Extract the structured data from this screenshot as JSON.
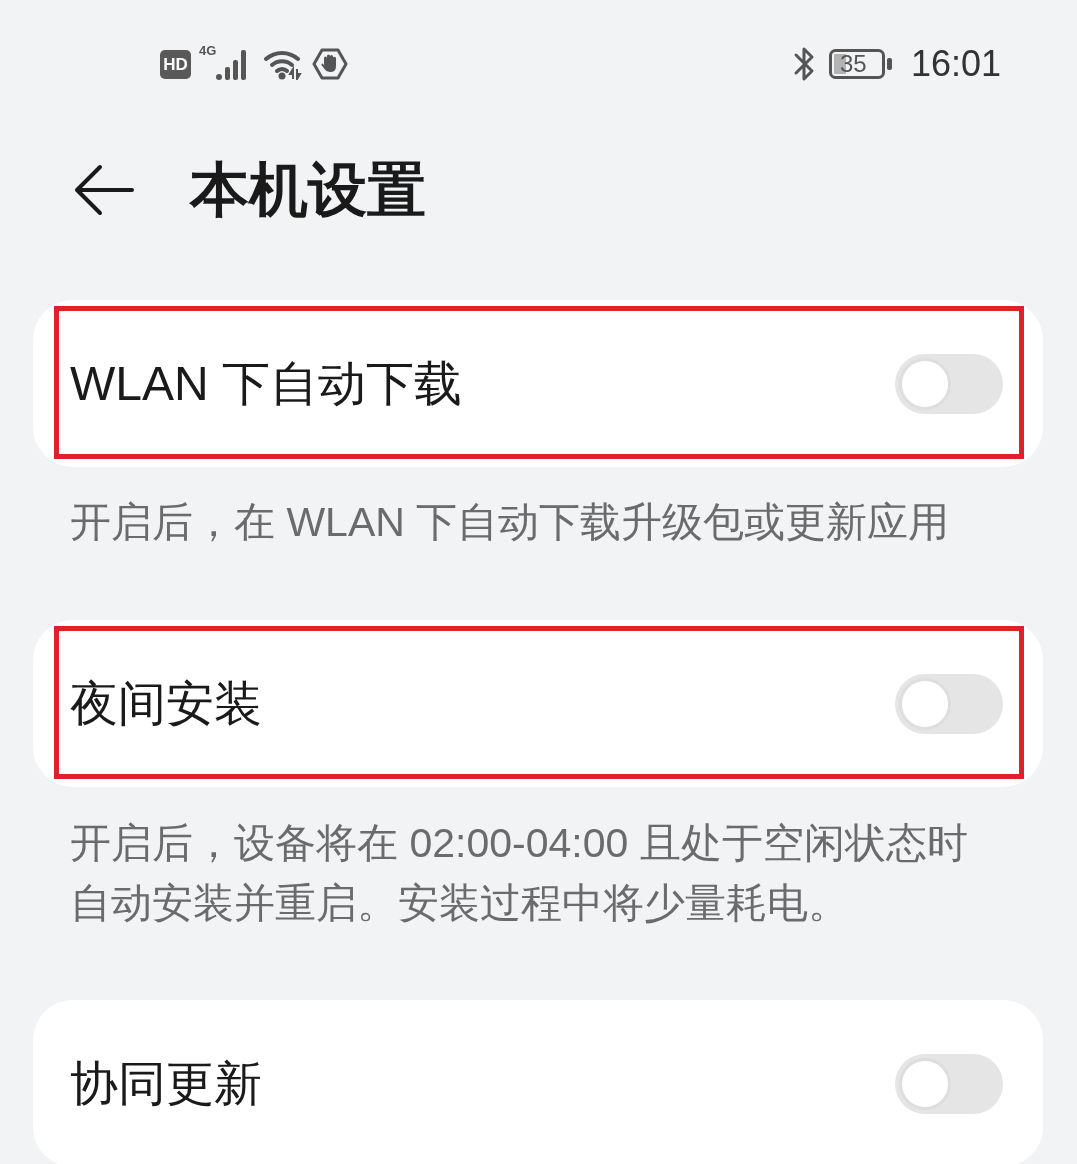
{
  "status_bar": {
    "hd_badge": "HD",
    "network_type": "4G",
    "battery": "35",
    "time": "16:01"
  },
  "header": {
    "title": "本机设置"
  },
  "settings": [
    {
      "label": "WLAN 下自动下载",
      "on": false,
      "highlighted": true,
      "description": "开启后，在 WLAN 下自动下载升级包或更新应用"
    },
    {
      "label": "夜间安装",
      "on": false,
      "highlighted": true,
      "description": "开启后，设备将在 02:00-04:00 且处于空闲状态时自动安装并重启。安装过程中将少量耗电。"
    },
    {
      "label": "协同更新",
      "on": false,
      "highlighted": false
    }
  ]
}
